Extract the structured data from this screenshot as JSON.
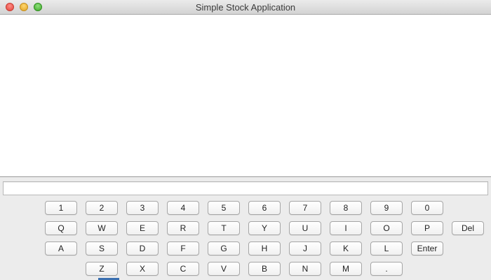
{
  "window": {
    "title": "Simple Stock Application"
  },
  "output": {
    "text": ""
  },
  "input": {
    "value": "",
    "placeholder": ""
  },
  "keyboard": {
    "row1": [
      "1",
      "2",
      "3",
      "4",
      "5",
      "6",
      "7",
      "8",
      "9",
      "0"
    ],
    "row2": [
      "Q",
      "W",
      "E",
      "R",
      "T",
      "Y",
      "U",
      "I",
      "O",
      "P",
      "Del"
    ],
    "row3": [
      "A",
      "S",
      "D",
      "F",
      "G",
      "H",
      "J",
      "K",
      "L",
      "Enter"
    ],
    "row4": [
      "Z",
      "X",
      "C",
      "V",
      "B",
      "N",
      "M",
      "."
    ]
  }
}
